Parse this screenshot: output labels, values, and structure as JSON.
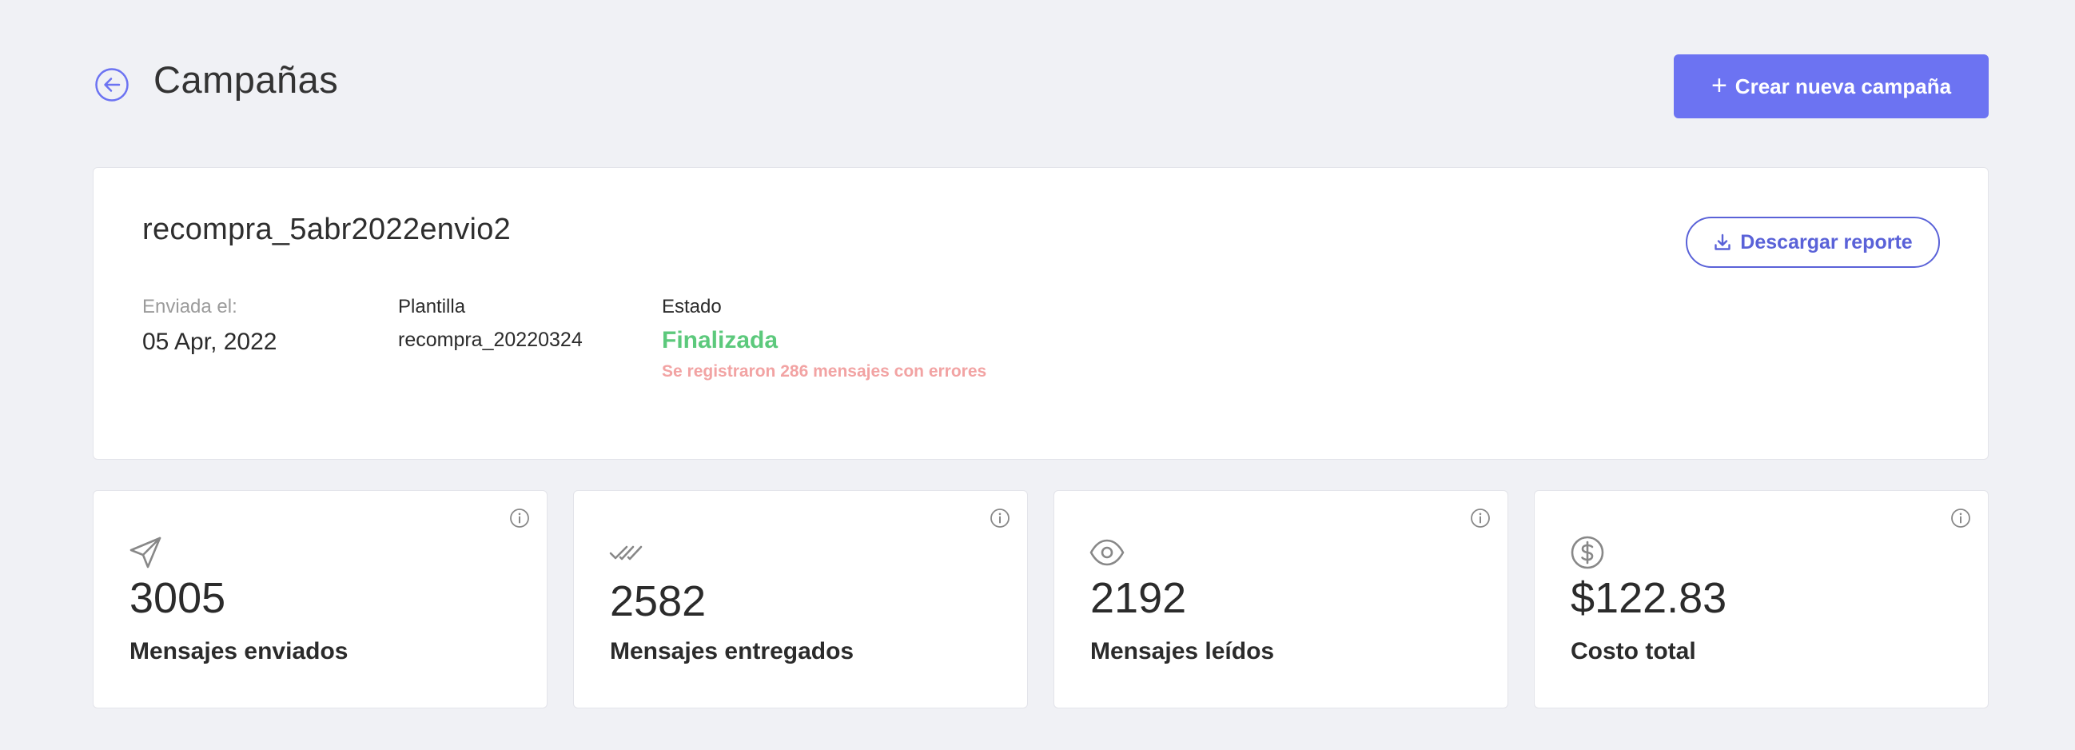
{
  "header": {
    "title": "Campañas",
    "create_button_label": "Crear nueva campaña"
  },
  "campaign": {
    "name": "recompra_5abr2022envio2",
    "download_label": "Descargar reporte",
    "sent_label": "Enviada el:",
    "sent_value": "05 Apr, 2022",
    "template_label": "Plantilla",
    "template_value": "recompra_20220324",
    "status_label": "Estado",
    "status_value": "Finalizada",
    "status_error": "Se registraron 286 mensajes con errores",
    "status_color": "#5cc97c",
    "error_color": "#f2a3a3"
  },
  "stats": [
    {
      "icon": "send-icon",
      "value": "3005",
      "label": "Mensajes enviados"
    },
    {
      "icon": "double-check-icon",
      "value": "2582",
      "label": "Mensajes entregados"
    },
    {
      "icon": "eye-icon",
      "value": "2192",
      "label": "Mensajes leídos"
    },
    {
      "icon": "dollar-icon",
      "value": "$122.83",
      "label": "Costo total"
    }
  ],
  "colors": {
    "accent": "#6c73f2",
    "background": "#f0f1f5"
  }
}
